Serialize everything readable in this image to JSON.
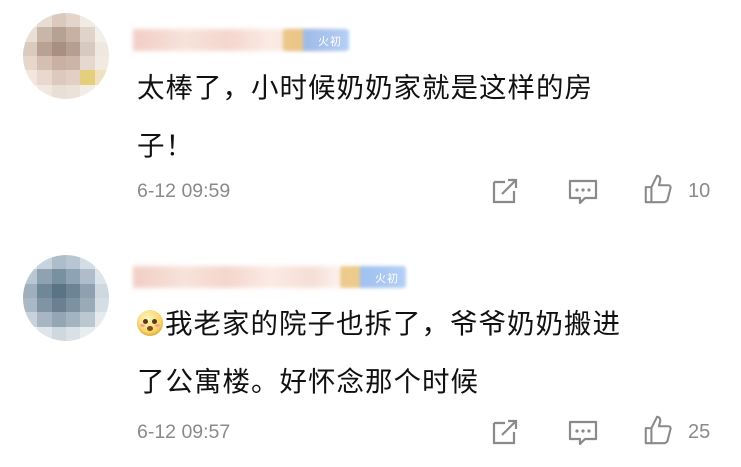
{
  "comments": [
    {
      "badge_text": "火初",
      "text": "太棒了，小时候奶奶家就是这样的房子！",
      "line1": "太棒了，小时候奶奶家就是这样的房",
      "line2": "子！",
      "time": "6-12 09:59",
      "likes": "10",
      "has_emoji": false,
      "avatar_colors": [
        "#f2ece6",
        "#e8ddd4",
        "#dcc9bd",
        "#e3d5cc",
        "#f1ebe6",
        "#f5f2ee",
        "#e9dfd7",
        "#c9b6a8",
        "#b7a193",
        "#c6b1a3",
        "#e0d3c9",
        "#f3efe9",
        "#d9cbc0",
        "#b9a293",
        "#a88f80",
        "#b69f91",
        "#d8c9bf",
        "#efe8e1",
        "#e8d6cc",
        "#d4bfb2",
        "#c9b0a2",
        "#ccb4a6",
        "#e6d8cf",
        "#f1e9e2",
        "#f2e6df",
        "#e8d8ce",
        "#ddc9bd",
        "#e2d0c5",
        "#e4cf7d",
        "#f0e2c1",
        "#f7f2ee",
        "#f1e8e2",
        "#eadfd6",
        "#ece2da",
        "#f3ede8",
        "#f8f5f2"
      ]
    },
    {
      "badge_text": "火初",
      "text": "我老家的院子也拆了，爷爷奶奶搬进了公寓楼。好怀念那个时候",
      "line1": "我老家的院子也拆了，爷爷奶奶搬进",
      "line2": "了公寓楼。好怀念那个时候",
      "time": "6-12 09:57",
      "likes": "25",
      "has_emoji": true,
      "avatar_colors": [
        "#dde6ee",
        "#c7d3de",
        "#aebdca",
        "#b7c6d2",
        "#d2dde6",
        "#eef2f5",
        "#b9c7d3",
        "#8ea2b2",
        "#7990a2",
        "#8ea3b3",
        "#aebdc9",
        "#dde4ea",
        "#9eb0be",
        "#6f8799",
        "#5a7385",
        "#6c8496",
        "#8fa1b0",
        "#cfd8df",
        "#a9b8c4",
        "#7f94a4",
        "#6a8092",
        "#7c91a1",
        "#9aabb8",
        "#d6dee5",
        "#c8d2db",
        "#a7b6c2",
        "#94a5b3",
        "#a3b3bf",
        "#bcc8d1",
        "#e6ebef",
        "#eef2f5",
        "#dfe5ea",
        "#d0d8df",
        "#d9e0e6",
        "#e8edf0",
        "#f5f7f9"
      ]
    }
  ],
  "colors": {
    "text": "#111111",
    "meta": "#8a8a8a",
    "icon": "#8a8a8a",
    "background": "#ffffff"
  },
  "icons": [
    "share-icon",
    "comment-icon",
    "like-icon"
  ]
}
